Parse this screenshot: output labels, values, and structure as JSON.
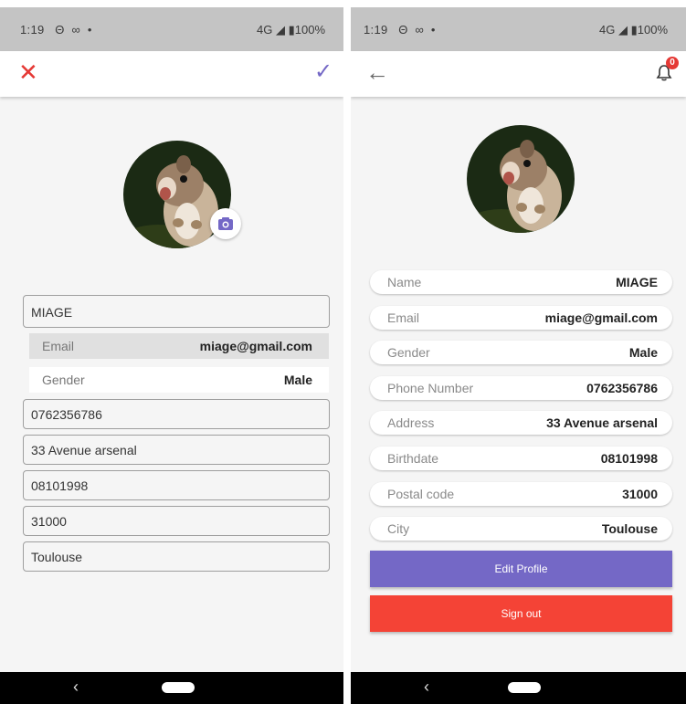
{
  "status_bar": {
    "time": "1:19",
    "left_icons": [
      "sim-icon",
      "voicemail-icon",
      "dot-icon"
    ],
    "network": "4G",
    "battery": "100%"
  },
  "edit_screen": {
    "close_icon": "close-icon",
    "save_icon": "check-icon",
    "avatar_icon": "camera-icon",
    "name_value": "MIAGE",
    "email_label": "Email",
    "email_value": "miage@gmail.com",
    "gender_label": "Gender",
    "gender_value": "Male",
    "phone_value": "0762356786",
    "address_value": "33 Avenue arsenal",
    "birthdate_value": "08101998",
    "postal_value": "31000",
    "city_value": "Toulouse"
  },
  "profile_screen": {
    "back_icon": "arrow-back-icon",
    "notification_icon": "bell-icon",
    "notification_count": "0",
    "rows": [
      {
        "label": "Name",
        "value": "MIAGE"
      },
      {
        "label": "Email",
        "value": "miage@gmail.com"
      },
      {
        "label": "Gender",
        "value": "Male"
      },
      {
        "label": "Phone Number",
        "value": "0762356786"
      },
      {
        "label": "Address",
        "value": "33 Avenue arsenal"
      },
      {
        "label": "Birthdate",
        "value": "08101998"
      },
      {
        "label": "Postal code",
        "value": "31000"
      },
      {
        "label": "City",
        "value": "Toulouse"
      }
    ],
    "edit_label": "Edit Profile",
    "signout_label": "Sign out"
  },
  "colors": {
    "accent": "#7468c6",
    "danger": "#f44336",
    "status_bar": "#c4c4c4",
    "background": "#f5f5f5"
  }
}
